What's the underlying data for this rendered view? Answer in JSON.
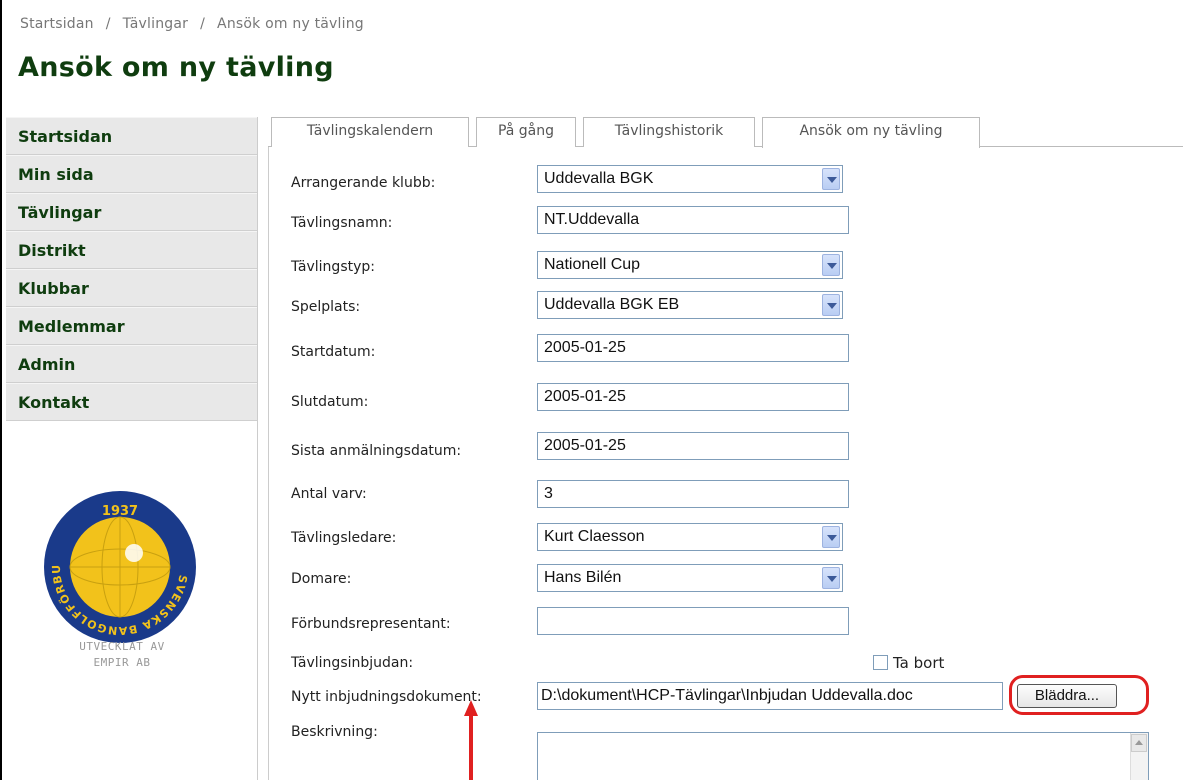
{
  "breadcrumb": {
    "items": [
      "Startsidan",
      "Tävlingar",
      "Ansök om ny tävling"
    ],
    "separator": "/"
  },
  "page_title": "Ansök om ny tävling",
  "sidebar": {
    "items": [
      {
        "label": "Startsidan"
      },
      {
        "label": "Min sida"
      },
      {
        "label": "Tävlingar"
      },
      {
        "label": "Distrikt"
      },
      {
        "label": "Klubbar"
      },
      {
        "label": "Medlemmar"
      },
      {
        "label": "Admin"
      },
      {
        "label": "Kontakt"
      }
    ],
    "logo": {
      "year": "1937",
      "ring_text": "SVENSKA BANGOLFFÖRBUNDET",
      "ring_color": "#1a3a8a",
      "fill_color": "#f2c21b"
    },
    "dev_note": [
      "UTVECKLAT AV",
      "EMPIR AB"
    ]
  },
  "tabs": [
    {
      "label": "Tävlingskalendern",
      "active": false
    },
    {
      "label": "På gång",
      "active": false
    },
    {
      "label": "Tävlingshistorik",
      "active": false
    },
    {
      "label": "Ansök om ny tävling",
      "active": true
    }
  ],
  "form": {
    "arrangerande_klubb": {
      "label": "Arrangerande klubb:",
      "value": "Uddevalla BGK"
    },
    "tavlingsnamn": {
      "label": "Tävlingsnamn:",
      "value": "NT.Uddevalla"
    },
    "tavlingstyp": {
      "label": "Tävlingstyp:",
      "value": "Nationell Cup"
    },
    "spelplats": {
      "label": "Spelplats:",
      "value": "Uddevalla BGK EB"
    },
    "startdatum": {
      "label": "Startdatum:",
      "value": "2005-01-25"
    },
    "slutdatum": {
      "label": "Slutdatum:",
      "value": "2005-01-25"
    },
    "sista_anmalningsdatum": {
      "label": "Sista anmälningsdatum:",
      "value": "2005-01-25"
    },
    "antal_varv": {
      "label": "Antal varv:",
      "value": "3"
    },
    "tavlingsledare": {
      "label": "Tävlingsledare:",
      "value": "Kurt Claesson"
    },
    "domare": {
      "label": "Domare:",
      "value": "Hans Bilén"
    },
    "forbundsrepresentant": {
      "label": "Förbundsrepresentant:",
      "value": ""
    },
    "tavlingsinbjudan": {
      "label": "Tävlingsinbjudan:",
      "remove_label": "Ta bort",
      "remove_checked": false
    },
    "nytt_dokument": {
      "label": "Nytt inbjudningsdokument:",
      "value": "D:\\dokument\\HCP-Tävlingar\\Inbjudan Uddevalla.doc",
      "browse_label": "Bläddra..."
    },
    "beskrivning": {
      "label": "Beskrivning:",
      "value": ""
    }
  },
  "colors": {
    "title_green": "#0f3d0f",
    "highlight_red": "#e02020",
    "input_border": "#7f9db9"
  }
}
